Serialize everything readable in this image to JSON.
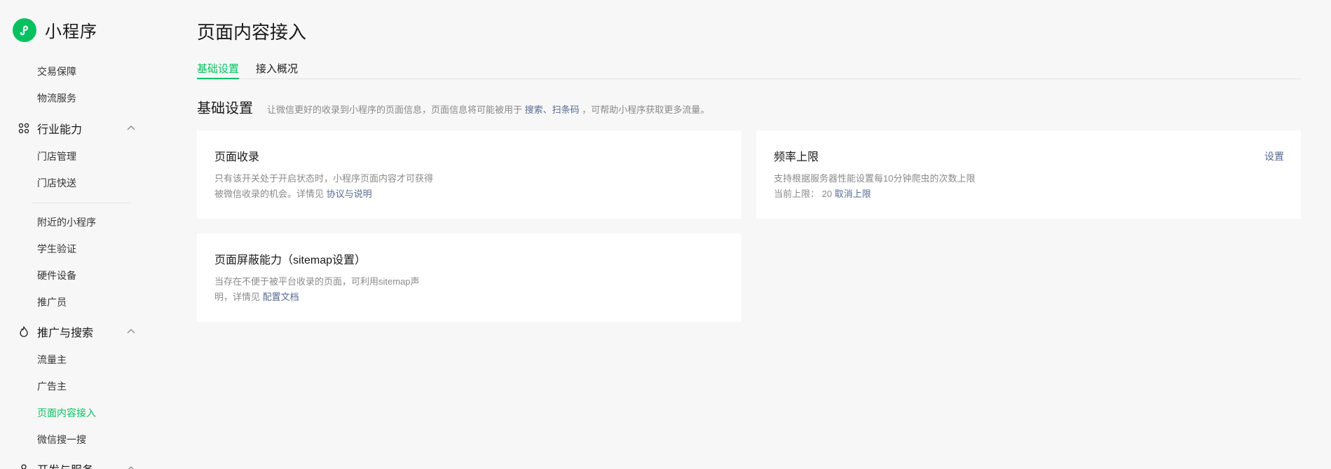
{
  "app": {
    "name": "小程序"
  },
  "sidebar": {
    "items_top": [
      {
        "label": "交易保障"
      },
      {
        "label": "物流服务"
      }
    ],
    "group_industry": {
      "label": "行业能力",
      "items": [
        {
          "label": "门店管理"
        },
        {
          "label": "门店快送"
        }
      ]
    },
    "items_mid": [
      {
        "label": "附近的小程序"
      },
      {
        "label": "学生验证"
      },
      {
        "label": "硬件设备"
      },
      {
        "label": "推广员"
      }
    ],
    "group_promo": {
      "label": "推广与搜索",
      "items": [
        {
          "label": "流量主"
        },
        {
          "label": "广告主"
        },
        {
          "label": "页面内容接入",
          "active": true
        },
        {
          "label": "微信搜一搜"
        }
      ]
    },
    "group_dev": {
      "label": "开发与服务"
    }
  },
  "main": {
    "title": "页面内容接入",
    "tabs": [
      {
        "label": "基础设置",
        "active": true
      },
      {
        "label": "接入概况"
      }
    ],
    "section": {
      "title": "基础设置",
      "desc_before": "让微信更好的收录到小程序的页面信息，页面信息将可能被用于",
      "desc_link": "搜索、扫条码",
      "desc_after": "，可帮助小程序获取更多流量。"
    },
    "cards": {
      "page_index": {
        "title": "页面收录",
        "line1": "只有该开关处于开启状态时，小程序页面内容才可获得",
        "line2": "被微信收录的机会。详情见",
        "link": "协议与说明"
      },
      "rate_limit": {
        "title": "频率上限",
        "action": "设置",
        "line1": "支持根据服务器性能设置每10分钟爬虫的次数上限",
        "current_label": "当前上限：",
        "current_value": "20",
        "link": "取消上限"
      },
      "sitemap": {
        "title": "页面屏蔽能力（sitemap设置）",
        "line1": "当存在不便于被平台收录的页面，可利用sitemap声",
        "line2": "明，详情见",
        "link": "配置文档"
      }
    }
  },
  "colors": {
    "accent": "#07c160",
    "link": "#576b95",
    "background": "#f7f7f7",
    "muted_text": "#8a8a8a"
  }
}
